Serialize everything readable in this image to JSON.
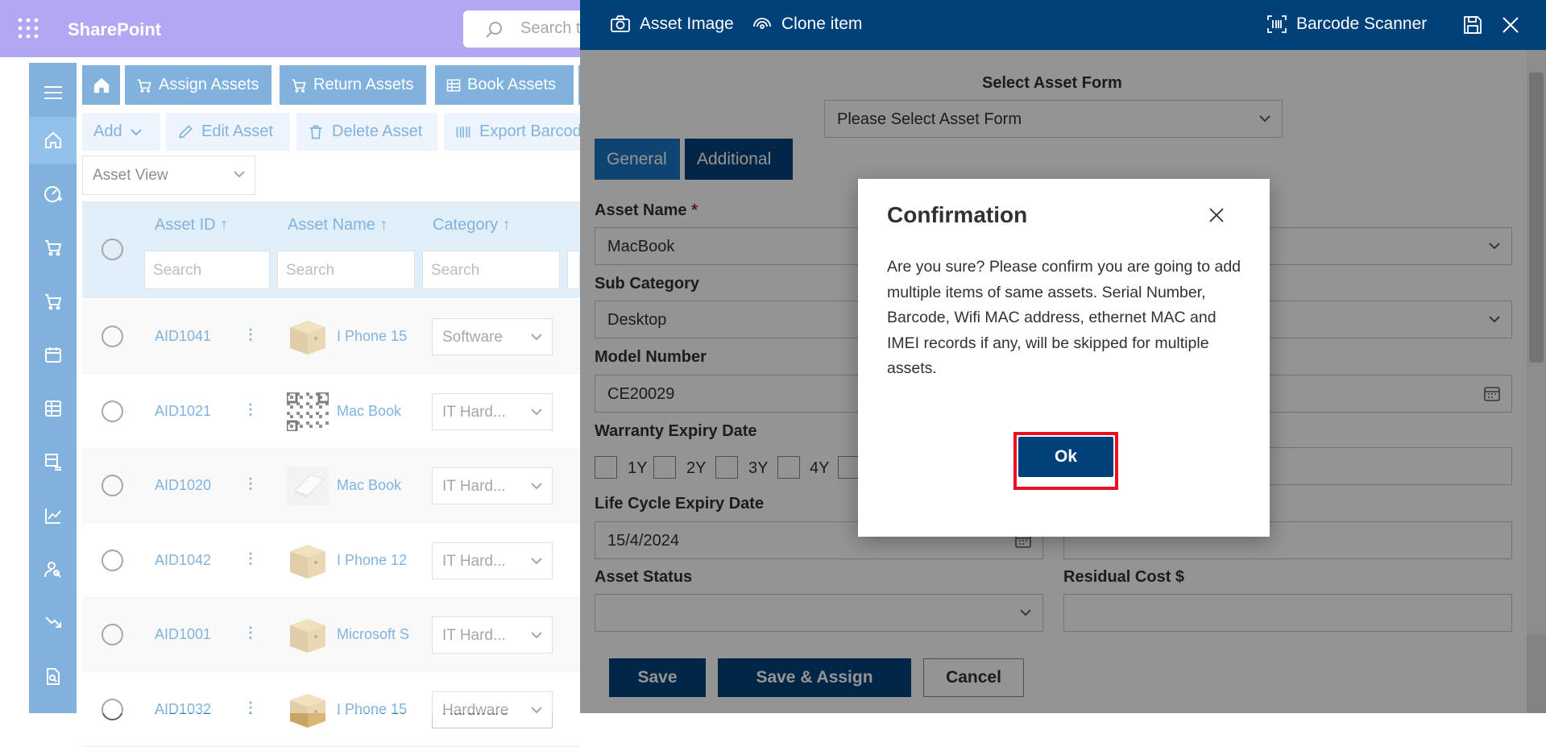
{
  "app": {
    "brand": "SharePoint",
    "search_placeholder": "Search t"
  },
  "toolbar": {
    "home_icon": "home-icon",
    "assign": "Assign Assets",
    "return": "Return Assets",
    "book": "Book Assets",
    "add": "Add",
    "edit": "Edit Asset",
    "delete": "Delete Asset",
    "export": "Export Barcod"
  },
  "view_select": "Asset View",
  "grid": {
    "columns": [
      "Asset ID ↑",
      "Asset Name ↑",
      "Category ↑"
    ],
    "filter_placeholder": "Search",
    "rows": [
      {
        "id": "AID1041",
        "name": "I Phone 15",
        "category": "Software",
        "img": "box"
      },
      {
        "id": "AID1021",
        "name": "Mac Book",
        "category": "IT Hard...",
        "img": "qr"
      },
      {
        "id": "AID1020",
        "name": "Mac Book",
        "category": "IT Hard...",
        "img": "laptop"
      },
      {
        "id": "AID1042",
        "name": "I Phone 12",
        "category": "IT Hard...",
        "img": "box"
      },
      {
        "id": "AID1001",
        "name": "Microsoft S",
        "category": "IT Hard...",
        "img": "box"
      },
      {
        "id": "AID1032",
        "name": "I Phone 15",
        "category": "Hardware",
        "img": "box"
      }
    ]
  },
  "panel": {
    "header": {
      "asset_image": "Asset Image",
      "clone": "Clone item",
      "barcode": "Barcode Scanner"
    },
    "select_form_label": "Select Asset Form",
    "select_form_value": "Please Select Asset Form",
    "tabs": {
      "general": "General",
      "additional": "Additional"
    },
    "asset_name_label": "Asset Name",
    "asset_name_required": "*",
    "asset_name_value": "MacBook",
    "sub_category_label": "Sub Category",
    "sub_category_value": "Desktop",
    "model_number_label": "Model Number",
    "model_number_value": "CE20029",
    "warranty_label": "Warranty Expiry Date",
    "warranty_options": [
      "1Y",
      "2Y",
      "3Y",
      "4Y"
    ],
    "lifecycle_label": "Life Cycle Expiry Date",
    "lifecycle_value": "15/4/2024",
    "asset_status_label": "Asset Status",
    "residual_label": "Residual Cost $",
    "buttons": {
      "save": "Save",
      "save_assign": "Save & Assign",
      "cancel": "Cancel"
    }
  },
  "dialog": {
    "title": "Confirmation",
    "body": "Are you sure? Please confirm you are going to add multiple items of same assets. Serial Number, Barcode, Wifi MAC address, ethernet MAC and IMEI records if any, will be skipped for multiple assets.",
    "ok": "Ok"
  },
  "colors": {
    "brand_purple": "#7160e8",
    "rail_blue": "#1a74c4",
    "panel_navy": "#00417a",
    "highlight_red": "#e81123"
  }
}
